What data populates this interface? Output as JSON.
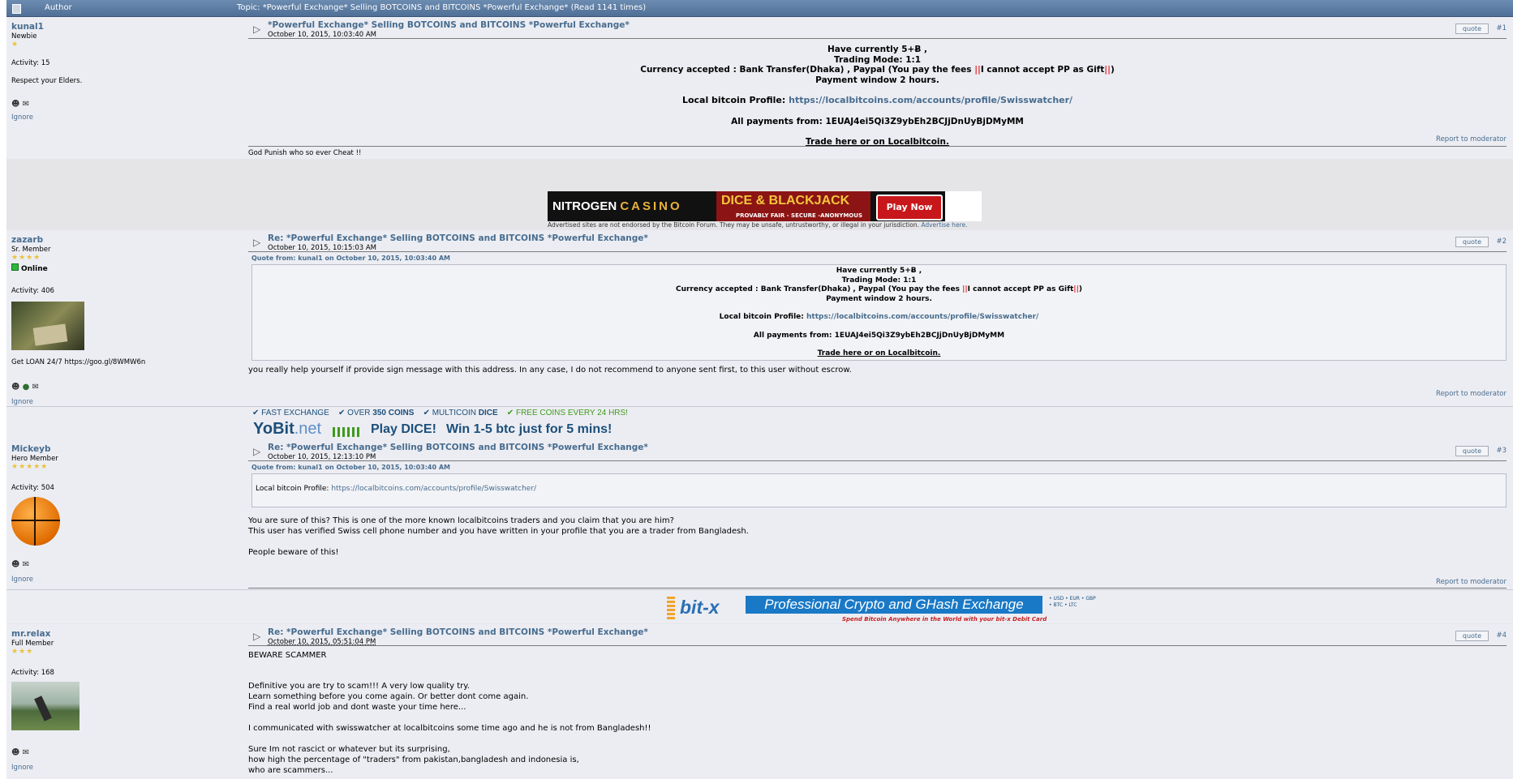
{
  "header": {
    "author_label": "Author",
    "topic_label": "Topic: *Powerful Exchange* Selling BOTCOINS and BITCOINS *Powerful Exchange*  (Read 1141 times)"
  },
  "common": {
    "quote": "quote",
    "report": "Report to moderator",
    "ignore": "Ignore"
  },
  "posts": [
    {
      "user": "kunal1",
      "rank": "Newbie",
      "stars": "★",
      "activity": "Activity: 15",
      "sig_left": "Respect your Elders.",
      "subject": "*Powerful Exchange* Selling BOTCOINS and BITCOINS *Powerful Exchange*",
      "date": "October 10, 2015, 10:03:40 AM",
      "num": "#1",
      "lines": {
        "l1": "Have currently 5+Ƀ ,",
        "l2": "Trading Mode: 1:1",
        "l3a": "Currency accepted : Bank Transfer(Dhaka) , Paypal (You pay the fees ",
        "l3bars": "||",
        "l3b": "I cannot accept PP as Gift",
        "l3c": ")",
        "l4": "Payment window 2 hours.",
        "l5a": "Local bitcoin Profile: ",
        "l5link": "https://localbitcoins.com/accounts/profile/Swisswatcher/",
        "l6": "All payments from: 1EUAJ4ei5Qi3Z9ybEh2BCJjDnUyBjDMyMM",
        "l7": "Trade here or on Localbitcoin."
      },
      "signature": "God Punish who so ever Cheat !!"
    },
    {
      "user": "zazarb",
      "rank": "Sr. Member",
      "stars": "★★★★",
      "online": "Online",
      "activity": "Activity: 406",
      "sig_left": "Get LOAN 24/7 https://goo.gl/8WMW6n",
      "subject": "Re: *Powerful Exchange* Selling BOTCOINS and BITCOINS *Powerful Exchange*",
      "date": "October 10, 2015, 10:15:03 AM",
      "num": "#2",
      "quote_head": "Quote from: kunal1 on October 10, 2015, 10:03:40 AM",
      "body": "you really help yourself if provide sign message with this address. In any case, I do not recommend to anyone sent first,  to this user without escrow."
    },
    {
      "user": "Mickeyb",
      "rank": "Hero Member",
      "stars": "★★★★★",
      "activity": "Activity: 504",
      "subject": "Re: *Powerful Exchange* Selling BOTCOINS and BITCOINS *Powerful Exchange*",
      "date": "October 10, 2015, 12:13:10 PM",
      "num": "#3",
      "quote_head": "Quote from: kunal1 on October 10, 2015, 10:03:40 AM",
      "quote_text": "Local bitcoin Profile: ",
      "quote_link": "https://localbitcoins.com/accounts/profile/Swisswatcher/",
      "b1": "You are sure of this? This is one of the more known localbitcoins traders and you claim that you are him?",
      "b2": "This user has verified Swiss cell phone number and you have written in your profile that you are a trader from Bangladesh.",
      "b3": "People beware of this!"
    },
    {
      "user": "mr.relax",
      "rank": "Full Member",
      "stars": "★★★",
      "activity": "Activity: 168",
      "subject": "Re: *Powerful Exchange* Selling BOTCOINS and BITCOINS *Powerful Exchange*",
      "date": "October 10, 2015, 05:51:04 PM",
      "num": "#4",
      "b1": "BEWARE SCAMMER",
      "b2": "Definitive you are try to scam!!! A very low quality try.",
      "b3": "Learn something before you come again. Or better dont come again.",
      "b4": "Find a real world job and dont waste your time here...",
      "b5": "I communicated with swisswatcher at localbitcoins some time ago and he is not from Bangladesh!!",
      "b6": "Sure Im not rascict or whatever but its surprising,",
      "b7": "how high the percentage of \"traders\" from pakistan,bangladesh and indonesia is,",
      "b8": "who are scammers..."
    }
  ],
  "ads": {
    "casino": {
      "a": "NITROGEN",
      "b": "CASINO",
      "c": "DICE & BLACKJACK",
      "d": "PROVABLY FAIR - SECURE -ANONYMOUS",
      "play": "Play Now",
      "disclaimer": "Advertised sites are not endorsed by the Bitcoin Forum. They may be unsafe, untrustworthy, or illegal in your jurisdiction. ",
      "adv": "Advertise here."
    },
    "yobit": {
      "f1": "✔ FAST EXCHANGE",
      "f2a": "✔ OVER ",
      "f2b": "350 COINS",
      "f3a": "✔ MULTICOIN ",
      "f3b": "DICE",
      "f4": "✔ FREE COINS EVERY 24 HRS!",
      "logo1": "YoBit",
      "logo2": ".net",
      "play": "Play DICE!",
      "win": "Win 1-5 btc just for 5 mins!"
    },
    "bitx": {
      "logo": "bit-x",
      "tag": "Professional Crypto and GHash Exchange",
      "small": "• USD • EUR • GBP • BTC • LTC",
      "spend": "Spend Bitcoin Anywhere in the World with your bit-x Debit Card"
    }
  },
  "colors": {
    "link": "#476c8e",
    "bar": "#4f6f96",
    "red": "#e02020",
    "star": "#ebc23d"
  }
}
